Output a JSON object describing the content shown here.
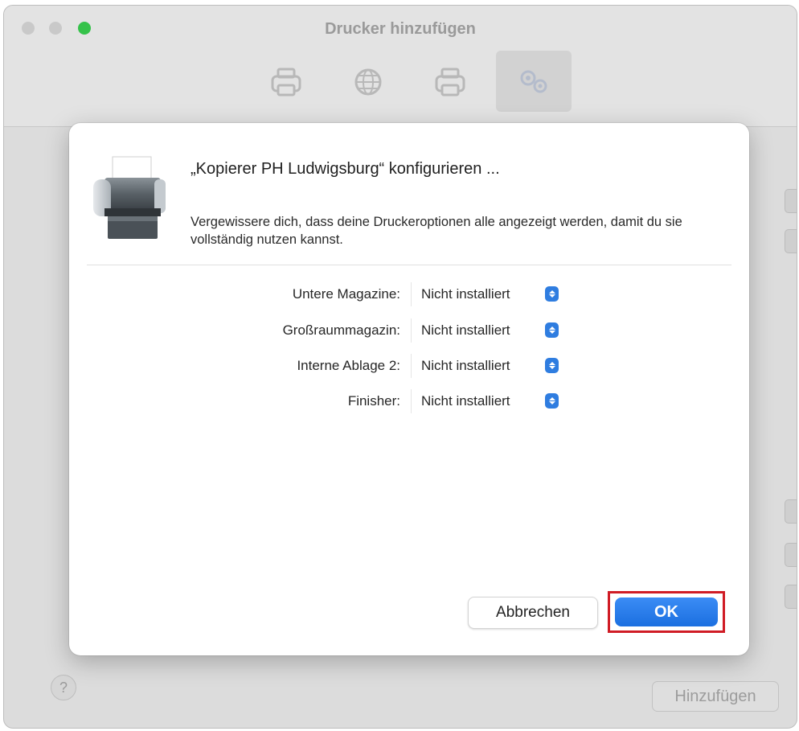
{
  "window": {
    "title": "Drucker hinzufügen",
    "toolbar_icons": [
      "printer-icon",
      "globe-icon",
      "printer-icon",
      "gear-icon"
    ],
    "add_button_label": "Hinzufügen",
    "help_label": "?"
  },
  "dialog": {
    "heading": "„Kopierer PH Ludwigsburg“ konfigurieren ...",
    "description": "Vergewissere dich, dass deine Druckeroptionen alle angezeigt werden, damit du sie vollständig nutzen kannst.",
    "options": [
      {
        "label": "Untere Magazine:",
        "value": "Nicht installiert"
      },
      {
        "label": "Großraummagazin:",
        "value": "Nicht installiert"
      },
      {
        "label": "Interne Ablage 2:",
        "value": "Nicht installiert"
      },
      {
        "label": "Finisher:",
        "value": "Nicht installiert"
      }
    ],
    "cancel_label": "Abbrechen",
    "ok_label": "OK"
  },
  "colors": {
    "accent": "#2f7de0",
    "highlight": "#d01c25",
    "traffic_green": "#35c24a"
  }
}
